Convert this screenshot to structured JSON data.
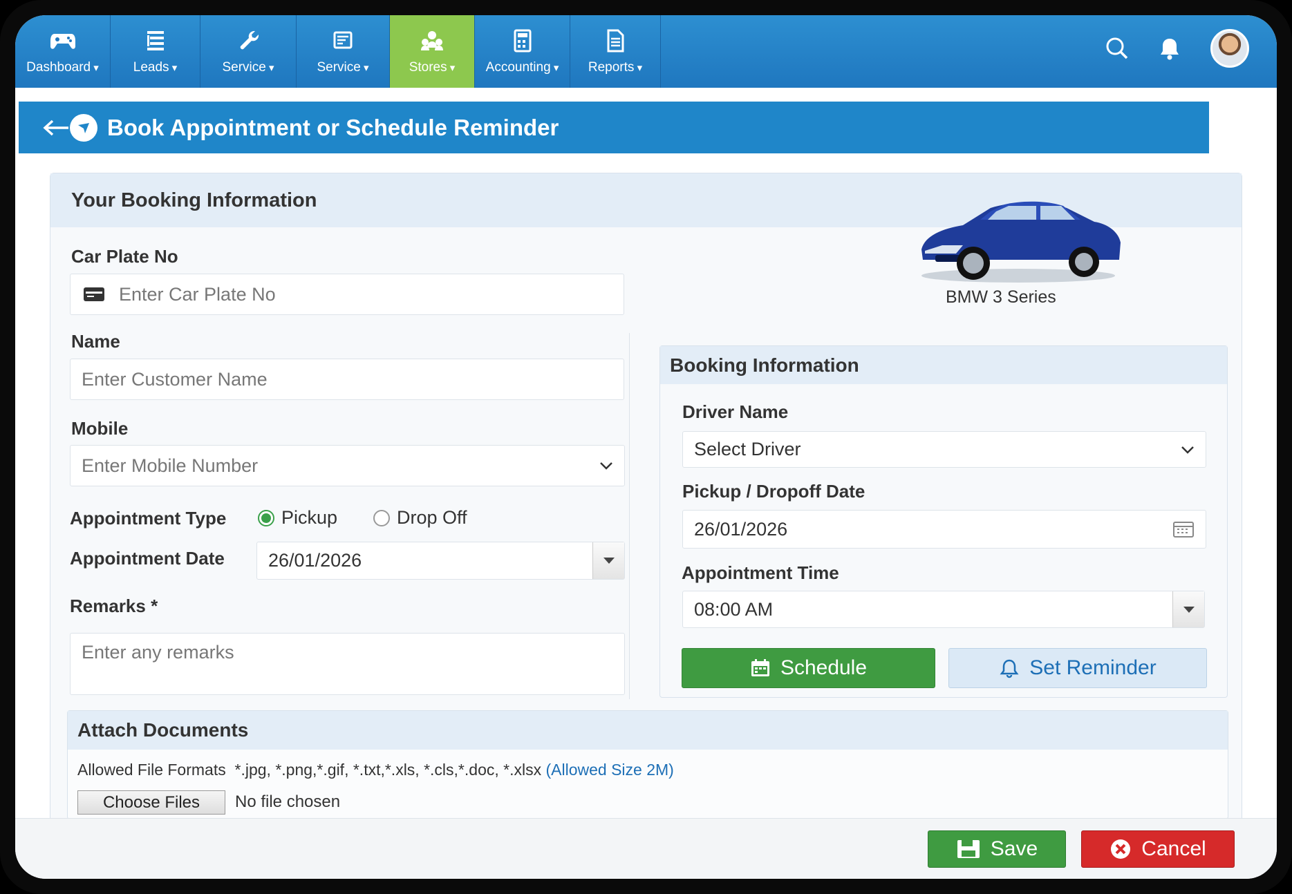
{
  "nav": {
    "items": [
      {
        "label": "Dashboard",
        "icon": "gamepad-icon"
      },
      {
        "label": "Leads",
        "icon": "list-icon"
      },
      {
        "label": "Service",
        "icon": "wrench-icon"
      },
      {
        "label": "Service",
        "icon": "card-icon"
      },
      {
        "label": "Stores",
        "icon": "people-icon",
        "active": true
      },
      {
        "label": "Accounting",
        "icon": "calculator-icon"
      },
      {
        "label": "Reports",
        "icon": "document-icon"
      }
    ],
    "active_color": "#8dc84e"
  },
  "page": {
    "title": "Book Appointment or Schedule Reminder"
  },
  "booking": {
    "section_title": "Your Booking Information",
    "car_plate_label": "Car Plate No",
    "car_plate_placeholder": "Enter Car Plate No",
    "name_label": "Name",
    "name_placeholder": "Enter Customer Name",
    "mobile_label": "Mobile",
    "mobile_placeholder": "Enter Mobile Number",
    "appt_type_label": "Appointment Type",
    "appt_type_options": [
      "Pickup",
      "Drop Off"
    ],
    "appt_type_selected": "Pickup",
    "appt_date_label": "Appointment Date",
    "appt_date_value": "26/01/2026",
    "remarks_label": "Remarks *",
    "remarks_placeholder": "Enter any remarks"
  },
  "car": {
    "model": "BMW 3 Series"
  },
  "info": {
    "section_title": "Booking Information",
    "driver_label": "Driver Name",
    "driver_value": "Select Driver",
    "pickup_label": "Pickup / Dropoff Date",
    "pickup_value": "26/01/2026",
    "time_label": "Appointment Time",
    "time_value": "08:00 AM",
    "schedule_btn": "Schedule",
    "reminder_btn": "Set Reminder"
  },
  "attach": {
    "title": "Attach Documents",
    "formats_label": "Allowed File Formats",
    "formats": "*.jpg, *.png,*.gif, *.txt,*.xls, *.cls,*.doc, *.xlsx",
    "size": "(Allowed Size 2M)",
    "choose_btn": "Choose Files",
    "no_file": "No file chosen"
  },
  "footer": {
    "save": "Save",
    "cancel": "Cancel"
  },
  "colors": {
    "primary": "#1f86c9",
    "success": "#3f9b41",
    "danger": "#d62a2a"
  }
}
